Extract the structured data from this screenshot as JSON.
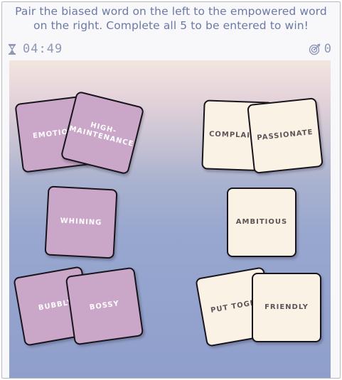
{
  "instructions": "Pair the biased word on the left to the empowered word on the right. Complete all 5 to be entered to win!",
  "timer": {
    "value": "04:49",
    "icon": "hourglass-icon"
  },
  "score": {
    "value": "0",
    "icon": "target-icon"
  },
  "cards": {
    "emotional": "EMOTIONAL",
    "high_maintenance_line1": "HIGH-",
    "high_maintenance_line2": "MAINTENANCE",
    "whining": "WHINING",
    "bubbly": "BUBBLY",
    "bossy": "BOSSY",
    "complains": "COMPLAINS",
    "passionate": "PASSIONATE",
    "ambitious": "AMBITIOUS",
    "put_together": "PUT TOGETHER",
    "friendly": "FRIENDLY"
  },
  "colors": {
    "biased_card": "#caa6c8",
    "empowered_card": "#fbf2e6",
    "instruction_text": "#6b79a6",
    "card_border": "#17151b"
  }
}
